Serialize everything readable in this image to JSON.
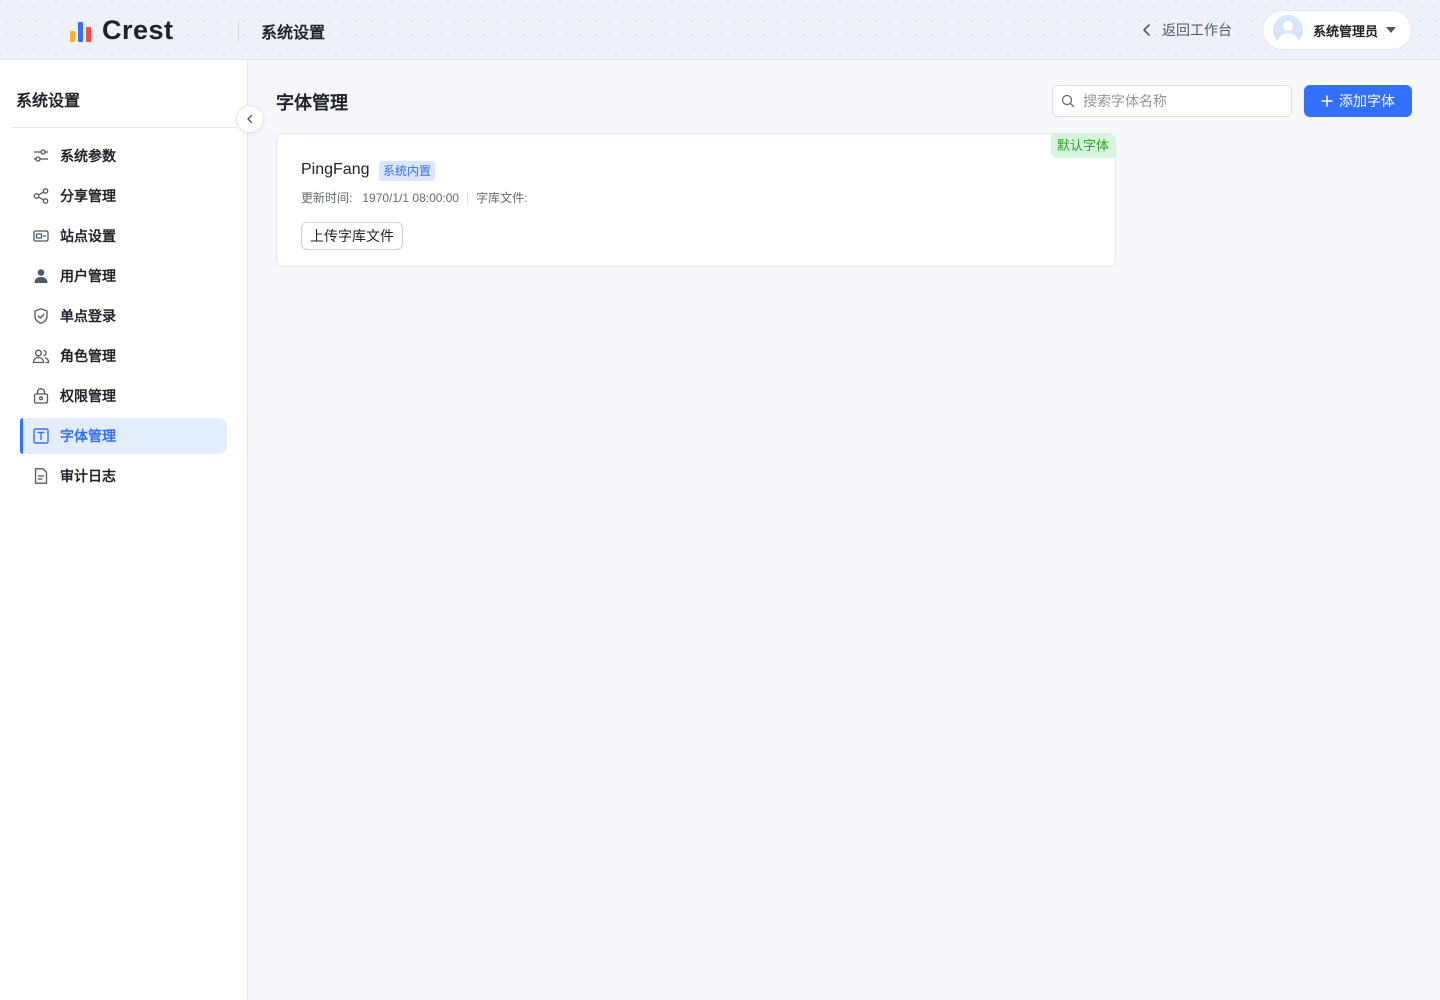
{
  "header": {
    "brand": "Crest",
    "title": "系统设置",
    "back_label": "返回工作台",
    "user_name": "系统管理员"
  },
  "sidebar": {
    "title": "系统设置",
    "items": [
      {
        "label": "系统参数",
        "icon": "sliders-icon",
        "active": false
      },
      {
        "label": "分享管理",
        "icon": "share-icon",
        "active": false
      },
      {
        "label": "站点设置",
        "icon": "site-icon",
        "active": false
      },
      {
        "label": "用户管理",
        "icon": "user-icon",
        "active": false
      },
      {
        "label": "单点登录",
        "icon": "shield-icon",
        "active": false
      },
      {
        "label": "角色管理",
        "icon": "users-icon",
        "active": false
      },
      {
        "label": "权限管理",
        "icon": "lock-icon",
        "active": false
      },
      {
        "label": "字体管理",
        "icon": "font-icon",
        "active": true
      },
      {
        "label": "审计日志",
        "icon": "document-icon",
        "active": false
      }
    ]
  },
  "main": {
    "title": "字体管理",
    "search_placeholder": "搜索字体名称",
    "add_label": "添加字体",
    "fonts": [
      {
        "name": "PingFang",
        "tag": "系统内置",
        "default_badge": "默认字体",
        "updated_label": "更新时间:",
        "updated_value": "1970/1/1 08:00:00",
        "file_label": "字库文件:",
        "upload_label": "上传字库文件"
      }
    ]
  },
  "colors": {
    "primary": "#3370ff",
    "default_badge_bg": "#d5f5dc",
    "default_badge_text": "#2ea121",
    "logo_bars": [
      "#ffb02e",
      "#3370ff",
      "#f54a45"
    ]
  }
}
